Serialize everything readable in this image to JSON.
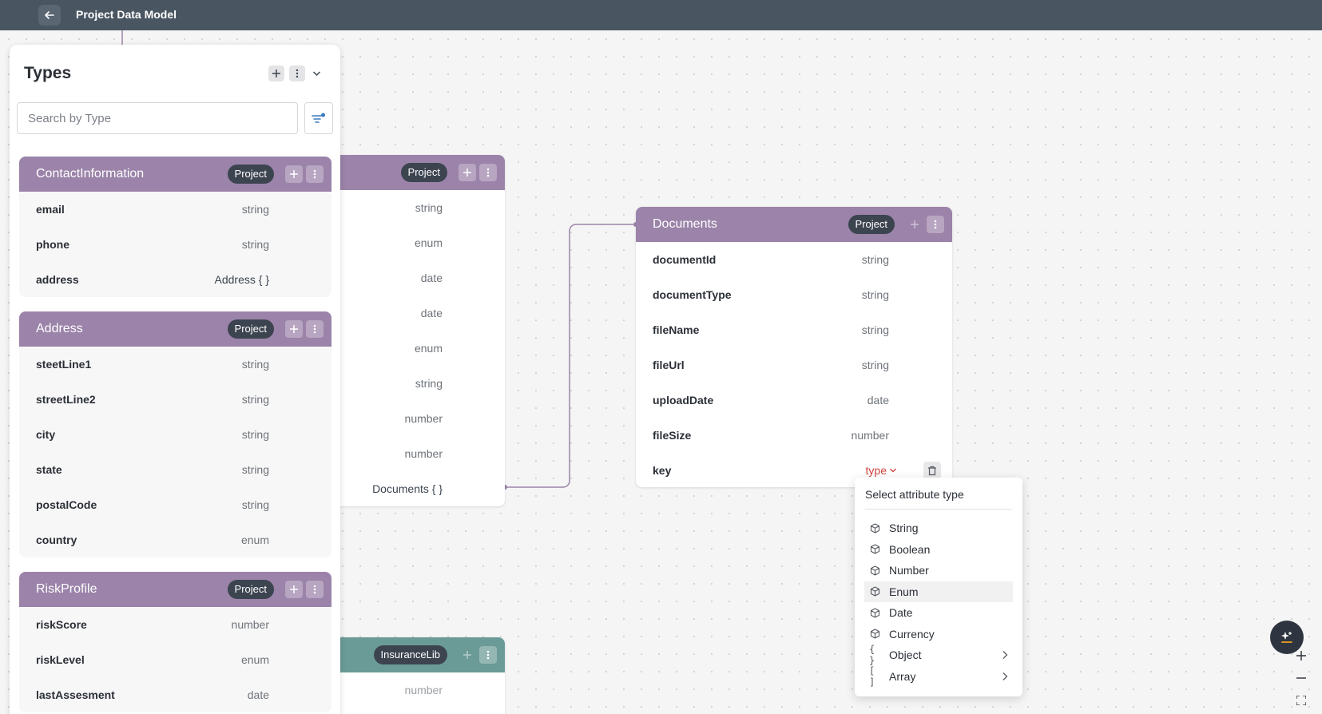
{
  "header": {
    "title": "Project Data Model"
  },
  "panel": {
    "title": "Types",
    "search_placeholder": "Search by Type",
    "cards": [
      {
        "title": "ContactInformation",
        "badge": "Project",
        "rows": [
          {
            "name": "email",
            "type": "string"
          },
          {
            "name": "phone",
            "type": "string"
          },
          {
            "name": "address",
            "type": "Address { }"
          }
        ]
      },
      {
        "title": "Address",
        "badge": "Project",
        "rows": [
          {
            "name": "steetLine1",
            "type": "string"
          },
          {
            "name": "streetLine2",
            "type": "string"
          },
          {
            "name": "city",
            "type": "string"
          },
          {
            "name": "state",
            "type": "string"
          },
          {
            "name": "postalCode",
            "type": "string"
          },
          {
            "name": "country",
            "type": "enum"
          }
        ]
      },
      {
        "title": "RiskProfile",
        "badge": "Project",
        "rows": [
          {
            "name": "riskScore",
            "type": "number"
          },
          {
            "name": "riskLevel",
            "type": "enum"
          },
          {
            "name": "lastAssesment",
            "type": "date"
          }
        ]
      }
    ]
  },
  "canvas": {
    "hidden_card": {
      "badge": "Project",
      "types": [
        "string",
        "enum",
        "date",
        "date",
        "enum",
        "string",
        "number",
        "number",
        "Documents { }"
      ]
    },
    "lower_card": {
      "badge": "InsuranceLib",
      "types": [
        "number"
      ]
    },
    "documents_card": {
      "title": "Documents",
      "badge": "Project",
      "rows": [
        {
          "name": "documentId",
          "type": "string"
        },
        {
          "name": "documentType",
          "type": "string"
        },
        {
          "name": "fileName",
          "type": "string"
        },
        {
          "name": "fileUrl",
          "type": "string"
        },
        {
          "name": "uploadDate",
          "type": "date"
        },
        {
          "name": "fileSize",
          "type": "number"
        }
      ],
      "new_row": {
        "name": "key",
        "type_placeholder": "type"
      }
    }
  },
  "type_menu": {
    "title": "Select attribute type",
    "items": [
      {
        "label": "String",
        "icon": "cube-icon"
      },
      {
        "label": "Boolean",
        "icon": "cube-icon"
      },
      {
        "label": "Number",
        "icon": "cube-icon"
      },
      {
        "label": "Enum",
        "icon": "cube-icon"
      },
      {
        "label": "Date",
        "icon": "cube-icon"
      },
      {
        "label": "Currency",
        "icon": "cube-icon"
      },
      {
        "label": "Object",
        "icon": "braces-icon"
      },
      {
        "label": "Array",
        "icon": "brackets-icon"
      }
    ],
    "highlighted": "Enum"
  },
  "colors": {
    "header_bg": "#4a5562",
    "project_card_header": "#9b83a9",
    "library_card_header": "#6b9b97",
    "badge_bg": "#3c4450",
    "error_type": "#d2453c"
  }
}
